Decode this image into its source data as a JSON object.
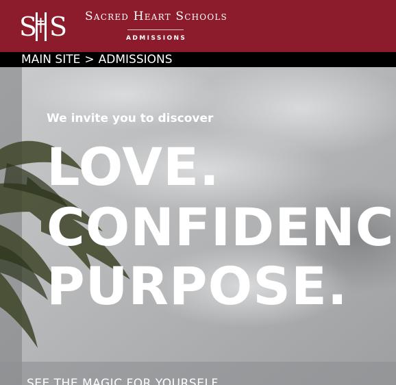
{
  "header": {
    "logo_text": "SHS",
    "school_name": "Sacred Heart Schools",
    "department": "ADMISSIONS",
    "brand_color": "#8c1c2b"
  },
  "breadcrumb": {
    "main_site": "MAIN SITE",
    "separator": ">",
    "current": "ADMISSIONS"
  },
  "hero": {
    "kicker": "We invite you to discover",
    "line1": "LOVE.",
    "line2": "CONFIDENCE.",
    "line3": "PURPOSE.",
    "cta": "SEE THE MAGIC FOR YOURSELF"
  }
}
